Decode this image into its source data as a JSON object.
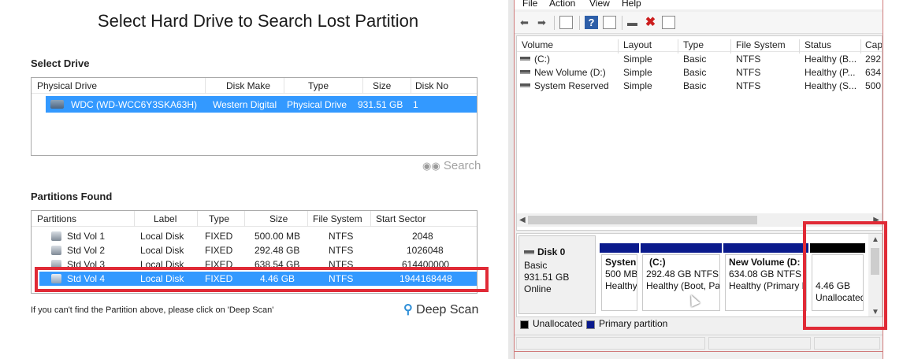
{
  "left": {
    "title": "Select Hard Drive to Search Lost Partition",
    "select_drive_label": "Select Drive",
    "drives_table": {
      "headers": [
        "Physical Drive",
        "Disk Make",
        "Type",
        "Size",
        "Disk No"
      ],
      "rows": [
        {
          "name": "WDC (WD-WCC6Y3SKA63H)",
          "make": "Western Digital",
          "type": "Physical Drive",
          "size": "931.51 GB",
          "disk_no": "1",
          "selected": true
        }
      ]
    },
    "search_label": "Search",
    "partitions_found_label": "Partitions Found",
    "partitions_table": {
      "headers": [
        "Partitions",
        "Label",
        "Type",
        "Size",
        "File System",
        "Start Sector"
      ],
      "rows": [
        {
          "name": "Std Vol 1",
          "label": "Local Disk",
          "type": "FIXED",
          "size": "500.00 MB",
          "fs": "NTFS",
          "start": "2048"
        },
        {
          "name": "Std Vol 2",
          "label": "Local Disk",
          "type": "FIXED",
          "size": "292.48 GB",
          "fs": "NTFS",
          "start": "1026048"
        },
        {
          "name": "Std Vol 3",
          "label": "Local Disk",
          "type": "FIXED",
          "size": "638.54 GB",
          "fs": "NTFS",
          "start": "614400000"
        },
        {
          "name": "Std Vol 4",
          "label": "Local Disk",
          "type": "FIXED",
          "size": "4.46 GB",
          "fs": "NTFS",
          "start": "1944168448",
          "selected": true
        }
      ]
    },
    "hint_text": "If you can't find the Partition above, please click on 'Deep Scan'",
    "deep_scan_label": "Deep Scan"
  },
  "disk_management": {
    "menu": [
      "File",
      "Action",
      "View",
      "Help"
    ],
    "toolbar_icons": [
      "back-arrow-icon",
      "forward-arrow-icon",
      "properties-icon",
      "help-icon",
      "list-icon",
      "connect-icon",
      "delete-icon",
      "console-icon"
    ],
    "volume_headers": [
      "Volume",
      "Layout",
      "Type",
      "File System",
      "Status",
      "Cap"
    ],
    "volumes": [
      {
        "volume": "(C:)",
        "layout": "Simple",
        "type": "Basic",
        "fs": "NTFS",
        "status": "Healthy (B...",
        "cap": "292."
      },
      {
        "volume": "New Volume (D:)",
        "layout": "Simple",
        "type": "Basic",
        "fs": "NTFS",
        "status": "Healthy (P...",
        "cap": "634."
      },
      {
        "volume": "System Reserved",
        "layout": "Simple",
        "type": "Basic",
        "fs": "NTFS",
        "status": "Healthy (S...",
        "cap": "500"
      }
    ],
    "disk": {
      "name": "Disk 0",
      "kind": "Basic",
      "size": "931.51 GB",
      "state": "Online"
    },
    "partitions": [
      {
        "title": "Systen",
        "line1": "500 MB",
        "line2": "Healthy"
      },
      {
        "title": "(C:)",
        "line1": "292.48 GB NTFS",
        "line2": "Healthy (Boot, Pa"
      },
      {
        "title": "New Volume  (D:",
        "line1": "634.08 GB NTFS",
        "line2": "Healthy (Primary P"
      },
      {
        "title": "",
        "line1": "4.46 GB",
        "line2": "Unallocated"
      }
    ],
    "legend": {
      "unallocated": "Unallocated",
      "primary": "Primary partition"
    },
    "colors": {
      "primary": "#0a1a8c",
      "unallocated": "#000000",
      "highlight": "#e02a36",
      "selection": "#3399ff"
    }
  }
}
